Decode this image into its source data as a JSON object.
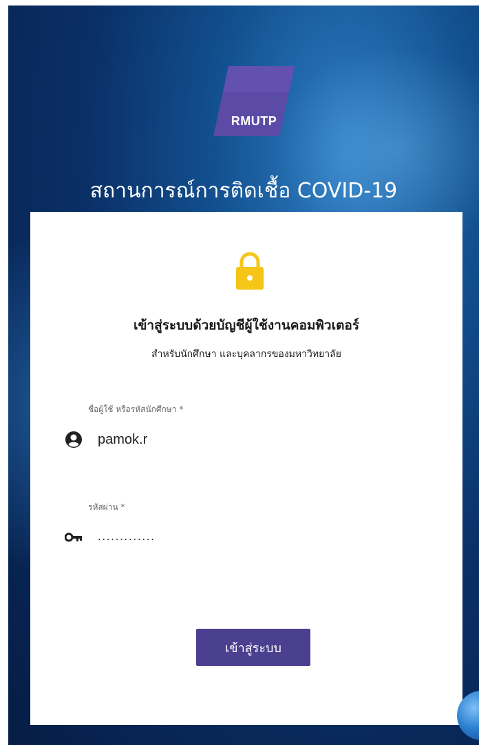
{
  "brand": {
    "logo_text": "RMUTP",
    "logo_color": "#5b4aa6"
  },
  "header": {
    "title": "สถานการณ์การติดเชื้อ COVID-19"
  },
  "login": {
    "lock_icon": "lock-icon",
    "heading": "เข้าสู่ระบบด้วยบัญชีผู้ใช้งานคอมพิวเตอร์",
    "subheading": "สำหรับนักศึกษา และบุคลากรของมหาวิทยาลัย",
    "username": {
      "label": "ชื่อผู้ใช้ หรือรหัสนักศึกษา *",
      "value": "pamok.r",
      "icon": "account-circle-icon"
    },
    "password": {
      "label": "รหัสผ่าน *",
      "value": ".............",
      "icon": "key-icon"
    },
    "submit_label": "เข้าสู่ระบบ",
    "submit_color": "#4b3f8f"
  },
  "colors": {
    "background_dark": "#061d45",
    "background_light": "#2f7fc4",
    "lock_color": "#f5c518"
  }
}
